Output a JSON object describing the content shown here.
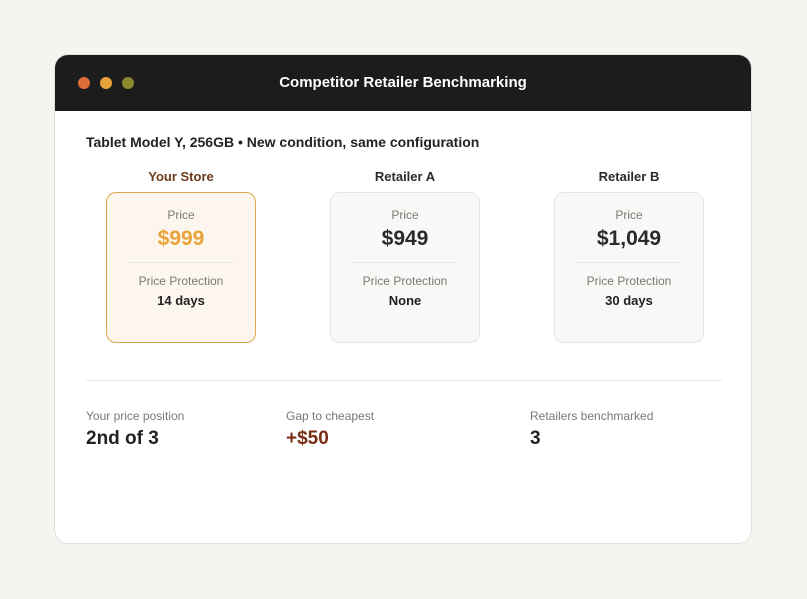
{
  "window": {
    "title": "Competitor Retailer Benchmarking",
    "controls": [
      {
        "name": "close",
        "color": "#e06c3c"
      },
      {
        "name": "minimize",
        "color": "#e8a23a"
      },
      {
        "name": "maximize",
        "color": "#8a8a2a"
      }
    ]
  },
  "product": {
    "subtitle": "Tablet Model Y, 256GB • New condition, same configuration"
  },
  "retailers": [
    {
      "name": "Your Store",
      "price_label": "Price",
      "price": "$999",
      "protection_label": "Price Protection",
      "protection": "14 days",
      "highlighted": true
    },
    {
      "name": "Retailer A",
      "price_label": "Price",
      "price": "$949",
      "protection_label": "Price Protection",
      "protection": "None",
      "highlighted": false
    },
    {
      "name": "Retailer B",
      "price_label": "Price",
      "price": "$1,049",
      "protection_label": "Price Protection",
      "protection": "30 days",
      "highlighted": false
    }
  ],
  "summary": {
    "position_label": "Your price position",
    "position_value": "2nd of 3",
    "gap_label": "Gap to cheapest",
    "gap_value": "+$50",
    "benchmarked_label": "Retailers benchmarked",
    "benchmarked_value": "3"
  },
  "colors": {
    "accent": "#e8a23a",
    "gap": "#7a2e16",
    "titlebar": "#1c1c1c"
  }
}
